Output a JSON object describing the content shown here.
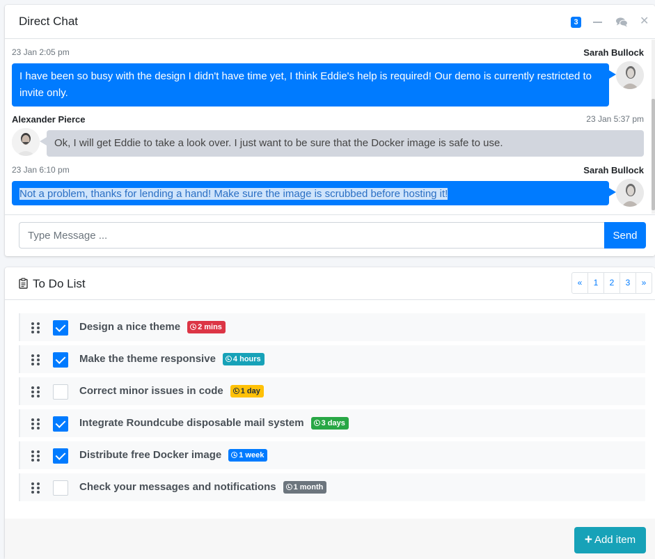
{
  "chat": {
    "title": "Direct Chat",
    "badge_count": "3",
    "messages": [
      {
        "name": "Sarah Bullock",
        "time": "23 Jan 2:05 pm",
        "text": "I have been so busy with the design I didn't have time yet, I think Eddie's help is required! Our demo is currently restricted to invite only."
      },
      {
        "name": "Alexander Pierce",
        "time": "23 Jan 5:37 pm",
        "text": "Ok, I will get Eddie to take a look over. I just want to be sure that the Docker image is safe to use."
      },
      {
        "name": "Sarah Bullock",
        "time": "23 Jan 6:10 pm",
        "text": "Not a problem, thanks for lending a hand! Make sure the image is scrubbed before hosting it!"
      }
    ],
    "input_placeholder": "Type Message ...",
    "send_label": "Send"
  },
  "todo": {
    "title": "To Do List",
    "pages": [
      "«",
      "1",
      "2",
      "3",
      "»"
    ],
    "items": [
      {
        "text": "Design a nice theme",
        "badge": "2 mins",
        "badge_color": "#dc3545",
        "checked": true
      },
      {
        "text": "Make the theme responsive",
        "badge": "4 hours",
        "badge_color": "#17a2b8",
        "checked": true
      },
      {
        "text": "Correct minor issues in code",
        "badge": "1 day",
        "badge_color": "#ffc107",
        "checked": false
      },
      {
        "text": "Integrate Roundcube disposable mail system",
        "badge": "3 days",
        "badge_color": "#28a745",
        "checked": true
      },
      {
        "text": "Distribute free Docker image",
        "badge": "1 week",
        "badge_color": "#007bff",
        "checked": true
      },
      {
        "text": "Check your messages and notifications",
        "badge": "1 month",
        "badge_color": "#6c757d",
        "checked": false
      }
    ],
    "add_label": "Add item"
  }
}
